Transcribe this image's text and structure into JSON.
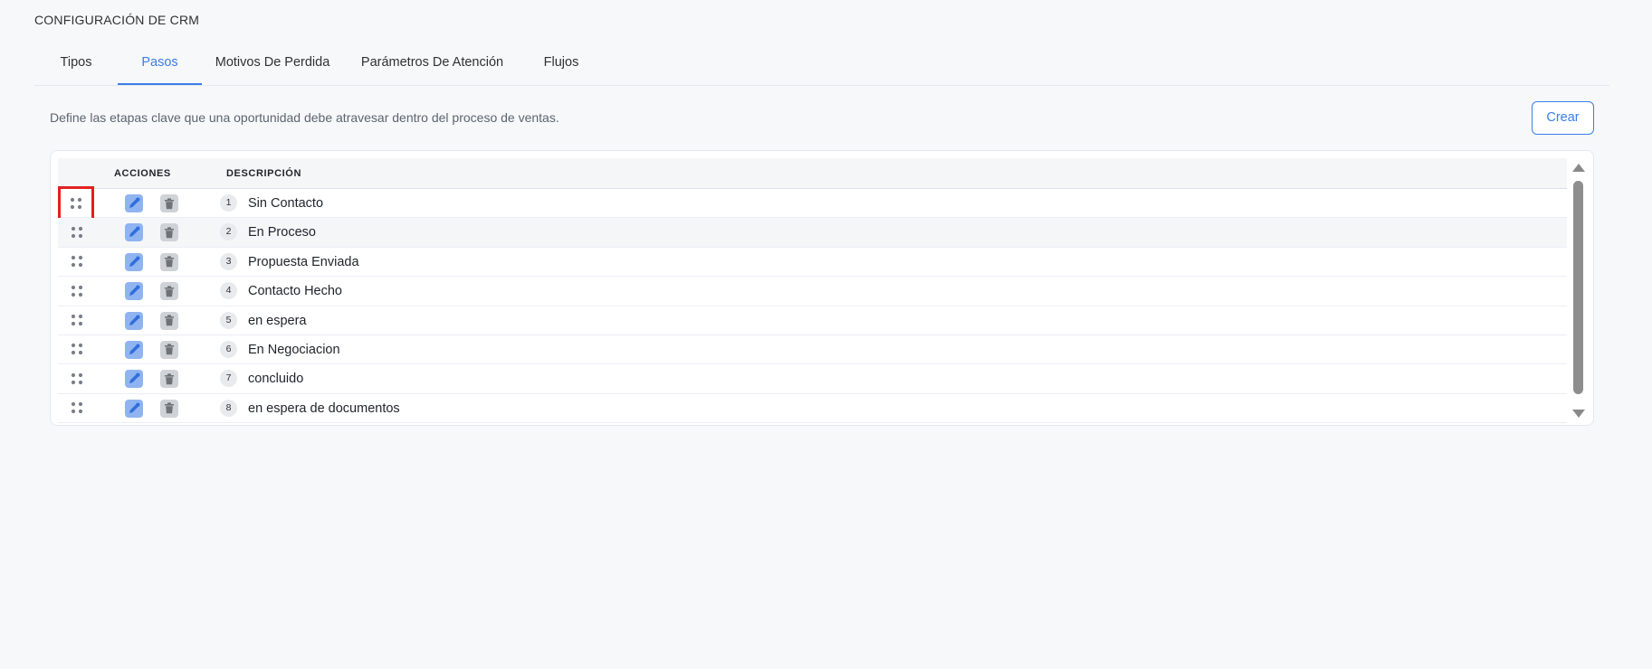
{
  "page": {
    "title": "CONFIGURACIÓN DE CRM"
  },
  "tabs": [
    {
      "label": "Tipos",
      "active": false
    },
    {
      "label": "Pasos",
      "active": true
    },
    {
      "label": "Motivos De Perdida",
      "active": false
    },
    {
      "label": "Parámetros De Atención",
      "active": false
    },
    {
      "label": "Flujos",
      "active": false
    }
  ],
  "toolbar": {
    "description": "Define las etapas clave que una oportunidad debe atravesar dentro del proceso de ventas.",
    "create_label": "Crear"
  },
  "table": {
    "columns": {
      "actions": "ACCIONES",
      "description": "DESCRIPCIÓN"
    },
    "rows": [
      {
        "order": "1",
        "label": "Sin Contacto"
      },
      {
        "order": "2",
        "label": "En Proceso"
      },
      {
        "order": "3",
        "label": "Propuesta Enviada"
      },
      {
        "order": "4",
        "label": "Contacto Hecho"
      },
      {
        "order": "5",
        "label": "en espera"
      },
      {
        "order": "6",
        "label": "En Negociacion"
      },
      {
        "order": "7",
        "label": "concluido"
      },
      {
        "order": "8",
        "label": "en espera de documentos"
      }
    ]
  },
  "icons": {
    "drag": "drag-handle-icon",
    "edit": "pencil-icon",
    "delete": "trash-icon",
    "scroll_up": "triangle-up-icon",
    "scroll_down": "triangle-down-icon"
  },
  "colors": {
    "accent": "#3a7ee8",
    "highlight": "#e02020",
    "background": "#f7f8fa"
  }
}
